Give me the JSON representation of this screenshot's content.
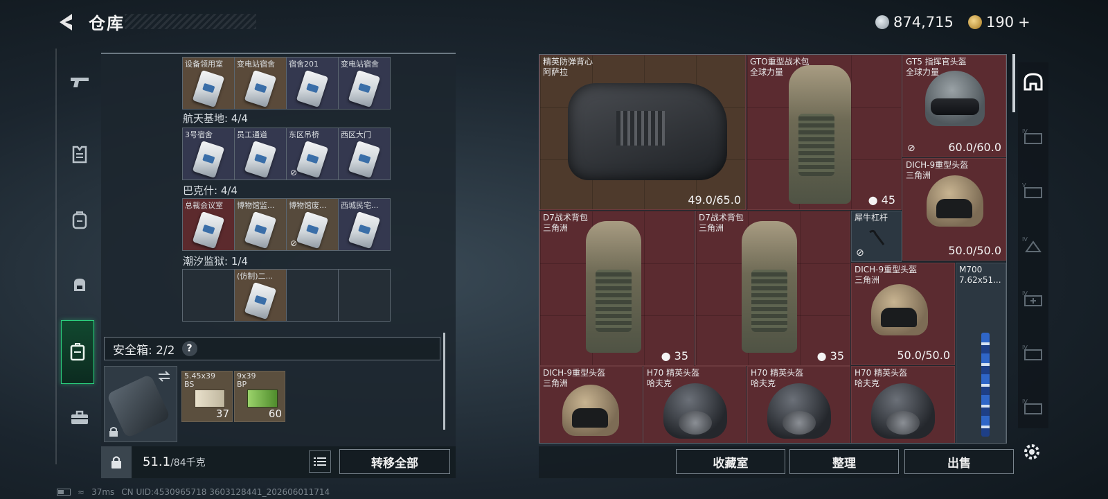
{
  "header": {
    "title": "仓库",
    "currency_silver": "874,715",
    "currency_gold": "190",
    "currency_gold_plus": "+"
  },
  "left_nav": [
    "gun-icon",
    "armor-vest-icon",
    "backpack-icon",
    "chest-rig-icon",
    "keycard-case-icon",
    "toolbox-icon"
  ],
  "keycards": {
    "top_row": [
      {
        "name": "设备领用室",
        "bg": "brown"
      },
      {
        "name": "变电站宿舍",
        "bg": "brown"
      },
      {
        "name": "宿舍201",
        "bg": "blue"
      },
      {
        "name": "变电站宿舍",
        "bg": "blue"
      }
    ],
    "sections": [
      {
        "label": "航天基地: 4/4",
        "cards": [
          {
            "name": "3号宿舍",
            "bg": "blue",
            "nobind": false
          },
          {
            "name": "员工通道",
            "bg": "blue",
            "nobind": false
          },
          {
            "name": "东区吊桥",
            "bg": "blue",
            "nobind": true
          },
          {
            "name": "西区大门",
            "bg": "blue",
            "nobind": false
          }
        ]
      },
      {
        "label": "巴克什: 4/4",
        "cards": [
          {
            "name": "总裁会议室",
            "bg": "red",
            "nobind": false
          },
          {
            "name": "博物馆监...",
            "bg": "cream",
            "nobind": false
          },
          {
            "name": "博物馆废...",
            "bg": "cream",
            "nobind": true
          },
          {
            "name": "西城民宅...",
            "bg": "blue",
            "nobind": false
          }
        ]
      },
      {
        "label": "潮汐监狱: 1/4",
        "cards": [
          {
            "name": "",
            "bg": "dark",
            "nobind": false
          },
          {
            "name": "(仿制)二...",
            "bg": "brown",
            "nobind": false
          },
          {
            "name": "",
            "bg": "dark",
            "nobind": false
          },
          {
            "name": "",
            "bg": "dark",
            "nobind": false
          }
        ]
      }
    ]
  },
  "safebox": {
    "label": "安全箱: 2/2",
    "help": "?"
  },
  "ammo": [
    {
      "name": "5.45x39\nBS",
      "count": "37"
    },
    {
      "name": "9x39\nBP",
      "count": "60"
    }
  ],
  "footer_left": {
    "weight": "51.1",
    "weight_max": "/84千克",
    "move_all": "转移全部"
  },
  "stash_items": [
    {
      "name": "精英防弹背心\n阿萨拉",
      "value": "49.0/65.0",
      "bg": "brown"
    },
    {
      "name": "GTO重型战术包\n全球力量",
      "value": "45",
      "bg": "red"
    },
    {
      "name": "GT5 指挥官头盔\n全球力量",
      "value": "60.0/60.0",
      "bg": "red",
      "nobind": true
    },
    {
      "name": "DICH-9重型头盔\n三角洲",
      "value": "50.0/50.0",
      "bg": "red"
    },
    {
      "name": "D7战术背包\n三角洲",
      "value": "35",
      "bg": "red"
    },
    {
      "name": "D7战术背包\n三角洲",
      "value": "35",
      "bg": "red"
    },
    {
      "name": "犀牛杠杆",
      "value": "",
      "bg": "slate",
      "nobind": true
    },
    {
      "name": "DICH-9重型头盔\n三角洲",
      "value": "50.0/50.0",
      "bg": "red"
    },
    {
      "name": "M700\n7.62x51...",
      "value": "",
      "bg": "slate"
    },
    {
      "name": "DICH-9重型头盔\n三角洲",
      "value": "",
      "bg": "red"
    },
    {
      "name": "H70 精英头盔\n哈夫克",
      "value": "",
      "bg": "red"
    },
    {
      "name": "H70 精英头盔\n哈夫克",
      "value": "",
      "bg": "red"
    },
    {
      "name": "H70 精英头盔\n哈夫克",
      "value": "",
      "bg": "red"
    }
  ],
  "footer_right": {
    "collection": "收藏室",
    "organize": "整理",
    "sell": "出售"
  },
  "right_tabs": [
    "helmet-filter-icon",
    "iv-case-icon",
    "v-case-icon",
    "iv-triangle-case-icon",
    "iv-plus-case-icon",
    "iv-case-icon-2",
    "iv-case-icon-3"
  ],
  "status_bar": {
    "ping": "37ms",
    "uid": "CN UID:4530965718 3603128441_202606011714"
  }
}
